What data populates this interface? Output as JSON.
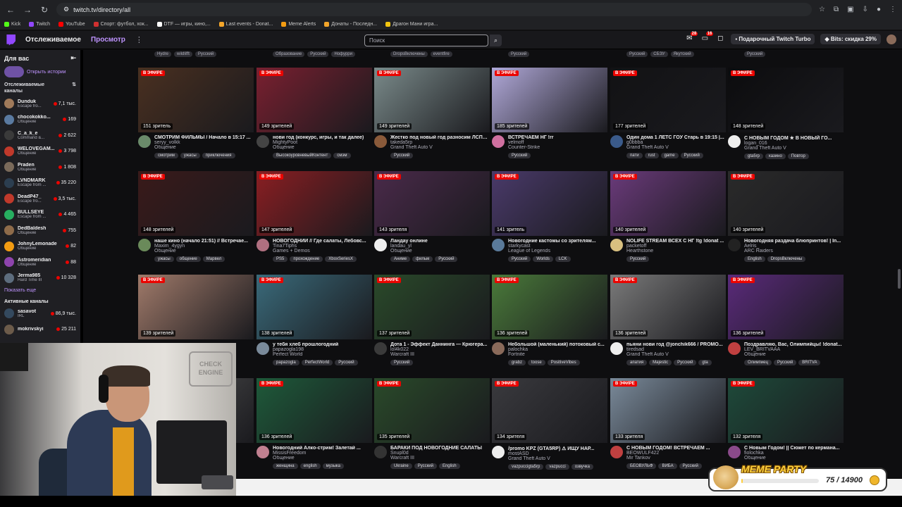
{
  "browser": {
    "url": "twitch.tv/directory/all",
    "bookmarks": [
      {
        "label": "Kick",
        "color": "#53fc18"
      },
      {
        "label": "Twitch",
        "color": "#9147ff"
      },
      {
        "label": "YouTube",
        "color": "#ff0000"
      },
      {
        "label": "Спорт: футбол, хок...",
        "color": "#d03030"
      },
      {
        "label": "DTF — игры, кино,...",
        "color": "#ffffff"
      },
      {
        "label": "Last events - Donat...",
        "color": "#f3a52a"
      },
      {
        "label": "Meme Alerts",
        "color": "#f39c12"
      },
      {
        "label": "Донаты - Последн...",
        "color": "#f3a52a"
      },
      {
        "label": "Драгон Мани игра...",
        "color": "#f1c40f"
      }
    ]
  },
  "header": {
    "following": "Отслеживаемое",
    "browse": "Просмотр",
    "search_placeholder": "Поиск",
    "notif_a": "28",
    "notif_b": "16",
    "turbo": "Подарочный Twitch Turbo",
    "bits": "Bits: скидка 29%"
  },
  "sidebar": {
    "title": "Для вас",
    "history": "Открыть истории",
    "followed_title": "Отслеживаемые каналы",
    "followed": [
      {
        "name": "Dunduk",
        "category": "Escape fro...",
        "viewers": "7,1 тыс.",
        "color": "#a07a5a"
      },
      {
        "name": "chocokokko...",
        "category": "Общение",
        "viewers": "169",
        "color": "#5a7aa0"
      },
      {
        "name": "C_a_k_e",
        "category": "Command &...",
        "viewers": "2 622",
        "color": "#3a3a3a"
      },
      {
        "name": "WELOVEGAM...",
        "category": "Общение",
        "viewers": "3 798",
        "color": "#c0392b"
      },
      {
        "name": "Praden",
        "category": "Общение",
        "viewers": "1 808",
        "color": "#7a6a5a"
      },
      {
        "name": "LVNDMARK",
        "category": "Escape from ...",
        "viewers": "35 220",
        "color": "#2c3e50"
      },
      {
        "name": "DeadP47_",
        "category": "Escape fro...",
        "viewers": "3,5 тыс.",
        "color": "#c0392b"
      },
      {
        "name": "BULLSEYE",
        "category": "Escape from ...",
        "viewers": "4 465",
        "color": "#27ae60"
      },
      {
        "name": "DedBaldesh",
        "category": "Общение",
        "viewers": "755",
        "color": "#8e6b4a"
      },
      {
        "name": "JohnyLemonade",
        "category": "Общение",
        "viewers": "82",
        "color": "#f39c12"
      },
      {
        "name": "Astromeridian",
        "category": "Общение",
        "viewers": "88",
        "color": "#8e44ad"
      },
      {
        "name": "Jerma985",
        "category": "Hard Time III",
        "viewers": "10 328",
        "color": "#5d6d7e"
      }
    ],
    "show_more": "Показать еще",
    "active_title": "Активные каналы",
    "active": [
      {
        "name": "sasavot",
        "category": "IRL",
        "viewers": "86,9 тыс.",
        "color": "#34495e"
      },
      {
        "name": "mokrivskyi",
        "category": "",
        "viewers": "25 211",
        "color": "#6c5b4a"
      }
    ]
  },
  "prev_row_tags": [
    [
      "Hydre",
      "wildlifft",
      "Русский"
    ],
    [
      "Образование",
      "Русский",
      "Нофурри"
    ],
    [
      "DropsВключены",
      "eventfire"
    ],
    [
      "Русский"
    ],
    [
      "Русский",
      "СБЭУ",
      "Якутский"
    ],
    [
      "Русский"
    ]
  ],
  "cards": [
    [
      {
        "title": "СМОТРИМ ФИЛЬМЫ / Начало в 15:17 ...",
        "channel": "seryy_volkk",
        "category": "Общение",
        "viewers": "151 зритель",
        "tags": [
          "смотрим",
          "ужасы",
          "приключения"
        ],
        "thumb": "#4a3020",
        "avatar": "#6a8a6a"
      },
      {
        "title": "нови год (конкурс, игры, и так далее)",
        "channel": "MightyPoot",
        "category": "Общение",
        "viewers": "149 зрителей",
        "tags": [
          "ВысокоуровневыйКонтент",
          "смэм"
        ],
        "thumb": "#7a2030",
        "avatar": "#444"
      },
      {
        "title": "Жестко под новый год разносим ЛСПД ...",
        "channel": "takeda5rp",
        "category": "Grand Theft Auto V",
        "viewers": "149 зрителей",
        "tags": [
          "Русский"
        ],
        "thumb": "#7a8a8a",
        "avatar": "#8a5a3a"
      },
      {
        "title": "ВСТРЕЧАЕМ НГ !rr",
        "channel": "velmoff",
        "category": "Counter-Strike",
        "viewers": "185 зрителей",
        "tags": [
          "Русский"
        ],
        "thumb": "#b0a8d8",
        "avatar": "#d070a0"
      },
      {
        "title": "Один дома 1 ЛЕТС ГОУ Старь в 19:15 |...",
        "channel": "g0bbba",
        "category": "Grand Theft Auto V",
        "viewers": "177 зрителей",
        "tags": [
          "пати",
          "rust",
          "game",
          "Русский"
        ],
        "thumb": "#121214",
        "avatar": "#3a5a8a"
      },
      {
        "title": "С НОВЫМ ГОДОМ ★ В НОВЫЙ ГО...",
        "channel": "logan_016",
        "category": "Grand Theft Auto V",
        "viewers": "148 зрителей",
        "tags": [
          "gta5rp",
          "казино",
          "Повтор"
        ],
        "thumb": "#0c0c0e",
        "avatar": "#eee"
      }
    ],
    [
      {
        "title": "наше кино (начало 21:51) // Встречае...",
        "channel": "Maxim_4ygyn",
        "category": "Общение",
        "viewers": "148 зрителей",
        "tags": [
          "ужасы",
          "общение",
          "Марвел"
        ],
        "thumb": "#3a1a1a",
        "avatar": "#6a8a5a"
      },
      {
        "title": "НОВОГОДНИЙ // Где салаты, Лебовс...",
        "channel": "Tina7Tiphs",
        "category": "Games + Demos",
        "viewers": "147 зрителей",
        "tags": [
          "PS5",
          "прохождение",
          "XboxSeriesX"
        ],
        "thumb": "#8a1e22",
        "avatar": "#b07080"
      },
      {
        "title": "Ландау онлине",
        "channel": "landau_yl",
        "category": "Общение",
        "viewers": "143 зрителя",
        "tags": [
          "Аниме",
          "фильм",
          "Русский"
        ],
        "thumb": "#4a2a4a",
        "avatar": "#eee"
      },
      {
        "title": "Новогодние кастомы со зрителям...",
        "channel": "starkycast",
        "category": "League of Legends",
        "viewers": "141 зритель",
        "tags": [
          "Русский",
          "Worlds",
          "LCK"
        ],
        "thumb": "#4a3a6a",
        "avatar": "#5a7a9a"
      },
      {
        "title": "NOLIFE STREAM ВСЕХ С НГ !tg !donat ...",
        "channel": "packetoff",
        "category": "Hearthstone",
        "viewers": "140 зрителей",
        "tags": [
          "Русский"
        ],
        "thumb": "#6a3a7a",
        "avatar": "#d8c080"
      },
      {
        "title": "Новогодняя раздача блюпринтов! | In...",
        "channel": "Aelris_",
        "category": "ARC Raiders",
        "viewers": "140 зрителей",
        "tags": [
          "English",
          "DropsВключены"
        ],
        "thumb": "#2a2a2a",
        "avatar": "#222"
      }
    ],
    [
      {
        "title": "",
        "channel": "",
        "category": "",
        "viewers": "139 зрителей",
        "tags": [],
        "thumb": "#a07a6a",
        "avatar": "#333"
      },
      {
        "title": "у тебя хлеб прошлогодний",
        "channel": "papazogla198",
        "category": "Perfect World",
        "viewers": "138 зрителей",
        "tags": [
          "papazogla",
          "PerfectWorld",
          "Русский"
        ],
        "thumb": "#3a6a7a",
        "avatar": "#7a8a9a"
      },
      {
        "title": "Дота 1 - Эффект Даннинга — Крюгера...",
        "channel": "lol4k022",
        "category": "Warcraft III",
        "viewers": "137 зрителей",
        "tags": [
          "Русский"
        ],
        "thumb": "#2a4a2a",
        "avatar": "#3a3a3a"
      },
      {
        "title": "Небольшой (маленький) потоковый с...",
        "channel": "palochka",
        "category": "Fortnite",
        "viewers": "136 зрителей",
        "tags": [
          "grabz",
          "toose",
          "PositiveVibes"
        ],
        "thumb": "#4a7a3a",
        "avatar": "#8a6a5a"
      },
      {
        "title": "пьяни нови год @jonchik666 / PROMO...",
        "channel": "tiredsad",
        "category": "Grand Theft Auto V",
        "viewers": "136 зрителей",
        "tags": [
          "апатия",
          "Majestic",
          "Русский",
          "gta"
        ],
        "thumb": "#7a7a7a",
        "avatar": "#eee"
      },
      {
        "title": "Поздравляю, Вас, Олимпийцы! !donat...",
        "channel": "LEV_BRITVAAA",
        "category": "Общение",
        "viewers": "136 зрителей",
        "tags": [
          "Олимпиец",
          "Русский",
          "BRITVA"
        ],
        "thumb": "#5a2a7a",
        "avatar": "#c04040"
      }
    ],
    [
      {
        "title": "",
        "channel": "",
        "category": "",
        "viewers": "",
        "tags": [],
        "thumb": "#555",
        "avatar": "#333"
      },
      {
        "title": "Новогодний Алко-стрим! Залетай ...",
        "channel": "MissisFreedom",
        "category": "Общение",
        "viewers": "136 зрителей",
        "tags": [
          "женщина",
          "english",
          "музыка"
        ],
        "thumb": "#1e5a3a",
        "avatar": "#c08090"
      },
      {
        "title": "БАРАКИ ПОД НОВОГОДНИЕ САЛАТЫ",
        "channel": "Snupl0d",
        "category": "Warcraft III",
        "viewers": "135 зрителей",
        "tags": [
          "Ukraine",
          "Русский",
          "English"
        ],
        "thumb": "#2a4a2a",
        "avatar": "#333"
      },
      {
        "title": "/promo KPZ (GTA5RP) ⚠ ИЩУ НАР...",
        "channel": "mostASD",
        "category": "Grand Theft Auto V",
        "viewers": "134 зрителя",
        "tags": [
          "vazpuccigta5rp",
          "vazpucci",
          "озвучка"
        ],
        "thumb": "#3a3a3e",
        "avatar": "#eee"
      },
      {
        "title": "С НОВЫМ ГОДОМ! ВСТРЕЧАЕМ ...",
        "channel": "BEOWULF422",
        "category": "Mir Tankov",
        "viewers": "133 зрителя",
        "tags": [
          "БЕОВУЛЬФ",
          "ВИБА",
          "Русский"
        ],
        "thumb": "#7a8a9a",
        "avatar": "#c04040"
      },
      {
        "title": "С Новым Годом! || Сюжет по кермана...",
        "channel": "fiolochka",
        "category": "Общение",
        "viewers": "132 зрителя",
        "tags": [],
        "thumb": "#1e4a3a",
        "avatar": "#8a4a8a"
      }
    ]
  ],
  "live_label": "В ЭФИРЕ",
  "cam_sign": "CHECK ENGINE",
  "meme_party": {
    "title": "MEME PARTY",
    "count": "75 / 14900",
    "progress": 0.005
  }
}
